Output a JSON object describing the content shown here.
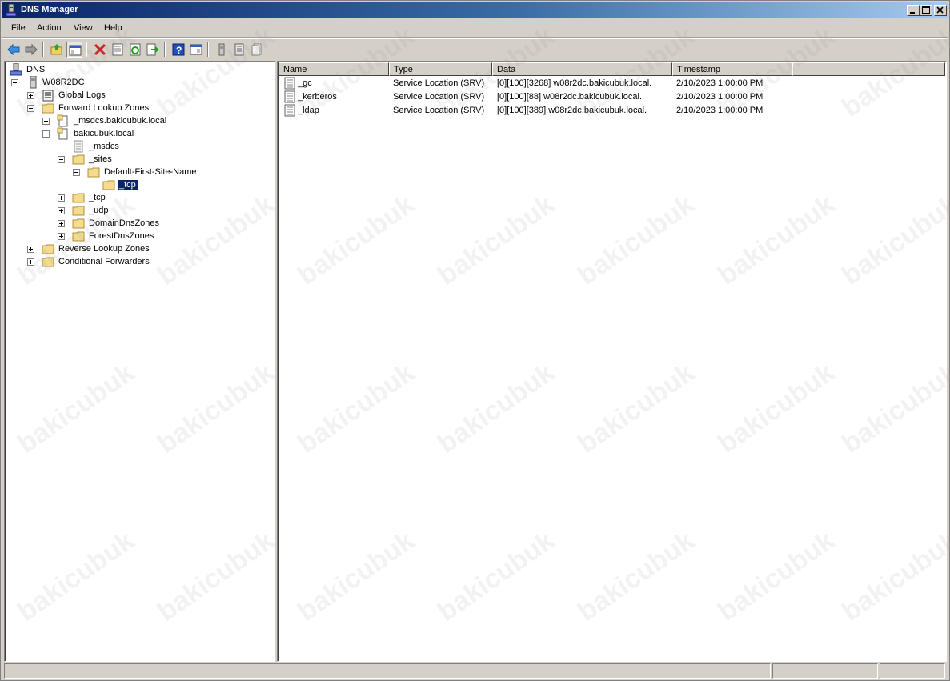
{
  "window": {
    "title": "DNS Manager"
  },
  "menu": [
    "File",
    "Action",
    "View",
    "Help"
  ],
  "toolbar": {
    "buttons": [
      "back-icon",
      "forward-icon",
      "up-folder-icon",
      "show-hide-tree-icon",
      "delete-icon",
      "properties-icon",
      "refresh-icon",
      "export-list-icon",
      "help-icon",
      "show-hide-action-pane-icon",
      "server-icon",
      "zone-icon",
      "new-record-icon"
    ]
  },
  "tree": {
    "root": "DNS",
    "server": "W08R2DC",
    "global_logs": "Global Logs",
    "forward_zones": "Forward Lookup Zones",
    "msdcs_zone": "_msdcs.bakicubuk.local",
    "domain_zone": "bakicubuk.local",
    "msdcs": "_msdcs",
    "sites": "_sites",
    "default_site": "Default-First-Site-Name",
    "tcp_selected": "_tcp",
    "tcp": "_tcp",
    "udp": "_udp",
    "domain_dns_zones": "DomainDnsZones",
    "forest_dns_zones": "ForestDnsZones",
    "reverse_zones": "Reverse Lookup Zones",
    "conditional_forwarders": "Conditional Forwarders"
  },
  "list": {
    "columns": [
      "Name",
      "Type",
      "Data",
      "Timestamp"
    ],
    "rows": [
      {
        "name": "_gc",
        "type": "Service Location (SRV)",
        "data": "[0][100][3268] w08r2dc.bakicubuk.local.",
        "timestamp": "2/10/2023 1:00:00 PM"
      },
      {
        "name": "_kerberos",
        "type": "Service Location (SRV)",
        "data": "[0][100][88] w08r2dc.bakicubuk.local.",
        "timestamp": "2/10/2023 1:00:00 PM"
      },
      {
        "name": "_ldap",
        "type": "Service Location (SRV)",
        "data": "[0][100][389] w08r2dc.bakicubuk.local.",
        "timestamp": "2/10/2023 1:00:00 PM"
      }
    ]
  },
  "watermark": "bakicubuk"
}
